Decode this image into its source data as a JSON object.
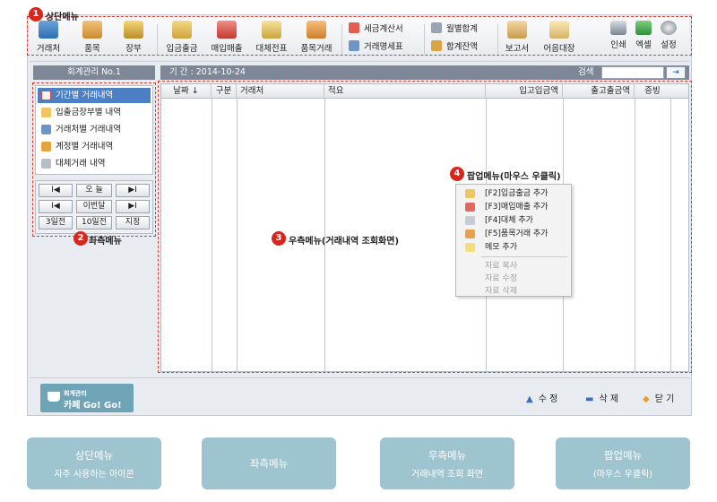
{
  "callouts": {
    "c1": {
      "num": "1",
      "label": "상단메뉴"
    },
    "c2": {
      "num": "2",
      "label": "좌측메뉴"
    },
    "c3": {
      "num": "3",
      "label": "우측메뉴(거래내역 조회화면)"
    },
    "c4": {
      "num": "4",
      "label": "팝업메뉴(마우스 우클릭)"
    }
  },
  "toolbar": {
    "partner": "거래처",
    "item": "품목",
    "ledger": "장부",
    "deposit_withdrawal": "입금출금",
    "purchase_sales": "매입매출",
    "transfer_slip": "대체전표",
    "item_trade": "품목거래",
    "tax_invoice": "세금계산서",
    "trade_statement": "거래명세표",
    "monthly_total": "월별합계",
    "total_balance": "합계잔액",
    "report": "보고서",
    "bill_ledger": "어음대장",
    "print": "인쇄",
    "excel": "엑셀",
    "settings": "설정"
  },
  "header": {
    "account_name": "회계관리 No.1",
    "period": "기 간 : 2014-10-24",
    "search_label": "검색",
    "search_placeholder": ""
  },
  "left_menu": {
    "items": [
      {
        "label": "기간별 거래내역",
        "icon": "calendar-icon",
        "active": true
      },
      {
        "label": "입출금장부별 내역",
        "icon": "notebook-icon",
        "active": false
      },
      {
        "label": "거래처별 거래내역",
        "icon": "partner-icon",
        "active": false
      },
      {
        "label": "계정별 거래내역",
        "icon": "scale-icon",
        "active": false
      },
      {
        "label": "대체거래 내역",
        "icon": "card-icon",
        "active": false
      }
    ]
  },
  "nav": {
    "prev1": "I◀",
    "today": "오 늘",
    "next1": "▶I",
    "prev2": "I◀",
    "this_month": "이번달",
    "next2": "▶I",
    "days3": "3일전",
    "days10": "10일전",
    "custom": "지정"
  },
  "table": {
    "columns": [
      "날짜 ↓",
      "구분",
      "거래처",
      "적요",
      "입고입금액",
      "출고출금액",
      "증빙"
    ],
    "rows": []
  },
  "popup": {
    "items": [
      {
        "label": "[F2]입금출금 추가",
        "icon": "deposit-icon",
        "enabled": true
      },
      {
        "label": "[F3]매입매출 추가",
        "icon": "purchase-icon",
        "enabled": true
      },
      {
        "label": "[F4]대체 추가",
        "icon": "transfer-icon",
        "enabled": true
      },
      {
        "label": "[F5]품목거래 추가",
        "icon": "item-trade-icon",
        "enabled": true
      },
      {
        "label": "메모 추가",
        "icon": "memo-icon",
        "enabled": true
      },
      {
        "label": "자료 복사",
        "icon": "",
        "enabled": false
      },
      {
        "label": "자료 수정",
        "icon": "",
        "enabled": false
      },
      {
        "label": "자료 삭제",
        "icon": "",
        "enabled": false
      }
    ]
  },
  "bottom": {
    "logo_line1": "회계관리",
    "logo_line2": "카페 Go! Go!",
    "edit": "수 정",
    "delete": "삭 제",
    "close": "닫 기"
  },
  "legend": {
    "top_title": "상단메뉴",
    "top_sub": "자주 사용하는 아이콘",
    "left_title": "좌측메뉴",
    "right_title": "우측메뉴",
    "right_sub": "거래내역 조회 화면",
    "popup_title": "팝업메뉴",
    "popup_sub": "(마우스 우클릭)"
  },
  "colors": {
    "callout_red": "#d9261c",
    "dashed_red": "#e03b30",
    "header_gray": "#7d8796",
    "active_blue": "#4d7fc4",
    "legend_teal": "#9ec4cf"
  }
}
